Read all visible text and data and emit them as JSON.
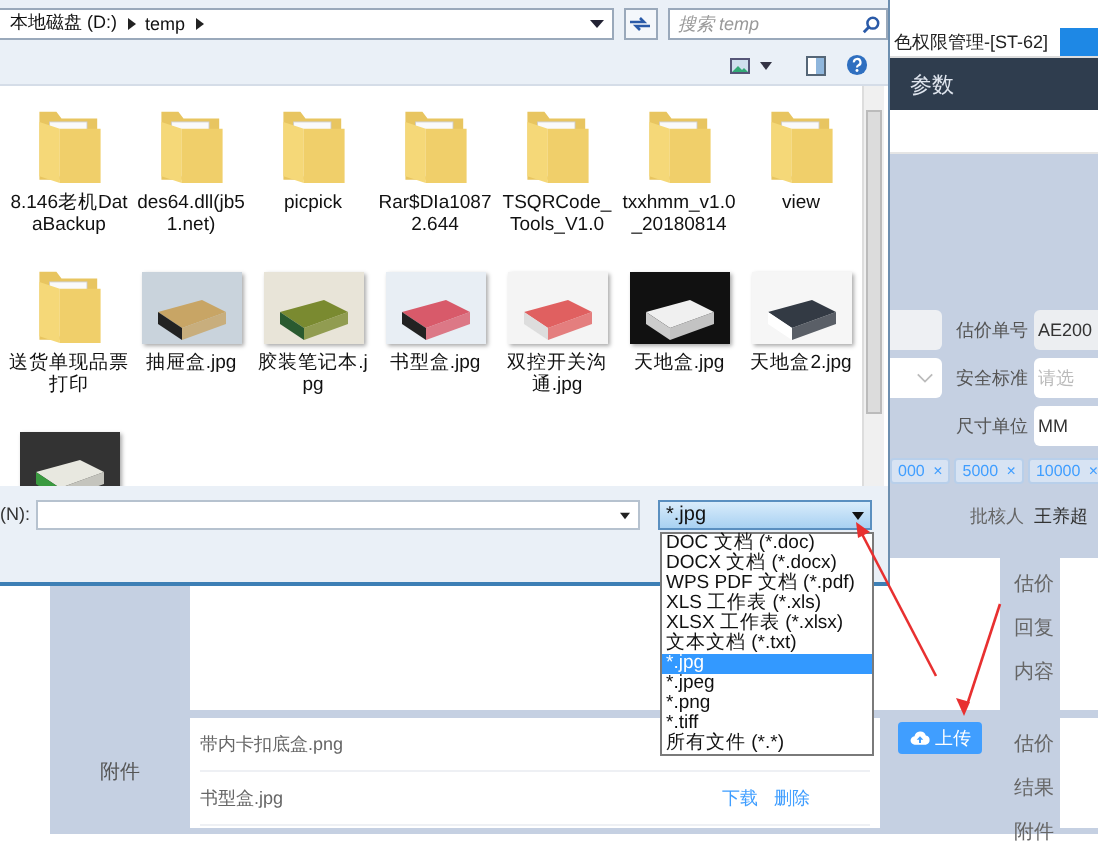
{
  "app": {
    "tab_title": "色权限管理-[ST-62]",
    "section": "参数",
    "fields": [
      {
        "label": "估价单号",
        "value": "AE200"
      },
      {
        "label": "安全标准",
        "placeholder": "请选"
      },
      {
        "label": "尺寸单位",
        "value": "MM"
      }
    ],
    "tags": [
      {
        "label": "000",
        "close": "×"
      },
      {
        "label": "5000",
        "close": "×"
      },
      {
        "label": "10000",
        "close": "×"
      }
    ],
    "approver": {
      "label": "批核人",
      "value": "王养超"
    },
    "reply_label": [
      "估价",
      "回复",
      "内容"
    ],
    "attachments": {
      "label": "附件",
      "files": [
        {
          "name": "带内卡扣底盒.png"
        },
        {
          "name": "书型盒.jpg",
          "actions": [
            "下载",
            "删除"
          ]
        }
      ]
    },
    "upload_button": "上传",
    "result_label": [
      "估价",
      "结果",
      "附件"
    ]
  },
  "dialog": {
    "address_path": [
      "本地磁盘 (D:)",
      "temp"
    ],
    "search": {
      "placeholder": "搜索 temp"
    },
    "files": [
      {
        "name": "8.146老机DataBackup",
        "kind": "folder"
      },
      {
        "name": "des64.dll(jb51.net)",
        "kind": "folder"
      },
      {
        "name": "picpick",
        "kind": "folder"
      },
      {
        "name": "Rar$DIa10872.644",
        "kind": "folder"
      },
      {
        "name": "TSQRCode_Tools_V1.0",
        "kind": "folder"
      },
      {
        "name": "txxhmm_v1.0_20180814",
        "kind": "folder"
      },
      {
        "name": "view",
        "kind": "folder"
      },
      {
        "name": "送货单现品票打印",
        "kind": "folder"
      },
      {
        "name": "抽屉盒.jpg",
        "kind": "picture"
      },
      {
        "name": "胶装笔记本.jpg",
        "kind": "picture"
      },
      {
        "name": "书型盒.jpg",
        "kind": "picture"
      },
      {
        "name": "双控开关沟通.jpg",
        "kind": "picture"
      },
      {
        "name": "天地盒.jpg",
        "kind": "picture"
      },
      {
        "name": "天地盒2.jpg",
        "kind": "picture"
      },
      {
        "kind": "picture"
      }
    ],
    "file_name": {
      "label": "(N):"
    },
    "file_type": {
      "value": "*.jpg",
      "options": [
        {
          "label": "DOC 文档 (*.doc)",
          "selected": false
        },
        {
          "label": "DOCX 文档 (*.docx)",
          "selected": false
        },
        {
          "label": "WPS PDF 文档 (*.pdf)",
          "selected": false
        },
        {
          "label": "XLS 工作表 (*.xls)",
          "selected": false
        },
        {
          "label": "XLSX 工作表 (*.xlsx)",
          "selected": false
        },
        {
          "label": "文本文档 (*.txt)",
          "selected": false
        },
        {
          "label": "*.jpg",
          "selected": true
        },
        {
          "label": "*.jpeg",
          "selected": false
        },
        {
          "label": "*.png",
          "selected": false
        },
        {
          "label": "*.tiff",
          "selected": false
        },
        {
          "label": "所有文件 (*.*)",
          "selected": false
        }
      ]
    }
  }
}
